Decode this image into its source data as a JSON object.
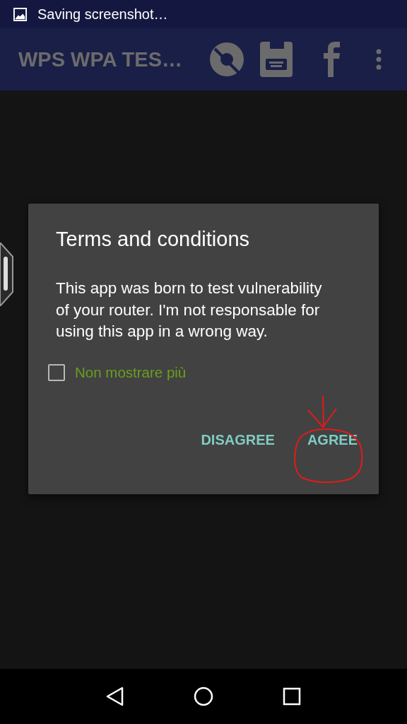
{
  "status_bar": {
    "notification": "Saving screenshot…"
  },
  "app_bar": {
    "title": "WPS WPA TES…"
  },
  "dialog": {
    "title": "Terms and conditions",
    "message": "This app was born to test vulnerability of your router. I'm not responsable for using this app in a wrong way.",
    "checkbox": {
      "label": "Non mostrare più",
      "checked": false
    },
    "buttons": [
      {
        "label": "DISAGREE"
      },
      {
        "label": "AGREE"
      }
    ]
  }
}
